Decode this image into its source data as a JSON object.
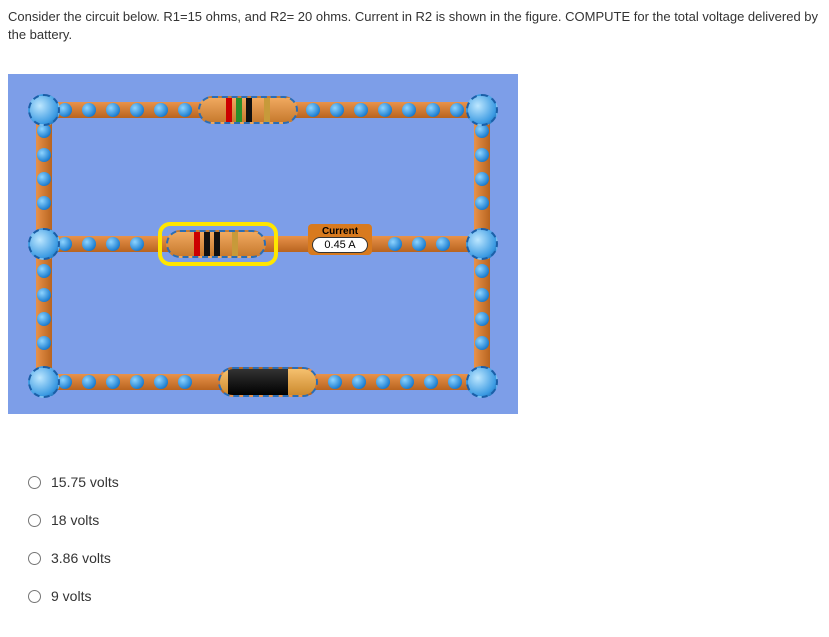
{
  "question": "Consider the circuit below.  R1=15 ohms, and R2= 20 ohms. Current in R2 is shown in the figure. COMPUTE for the total voltage delivered by the battery.",
  "ammeter": {
    "label": "Current",
    "value": "0.45 A"
  },
  "options": [
    {
      "label": "15.75 volts"
    },
    {
      "label": "18 volts"
    },
    {
      "label": "3.86 volts"
    },
    {
      "label": "9 volts"
    }
  ]
}
